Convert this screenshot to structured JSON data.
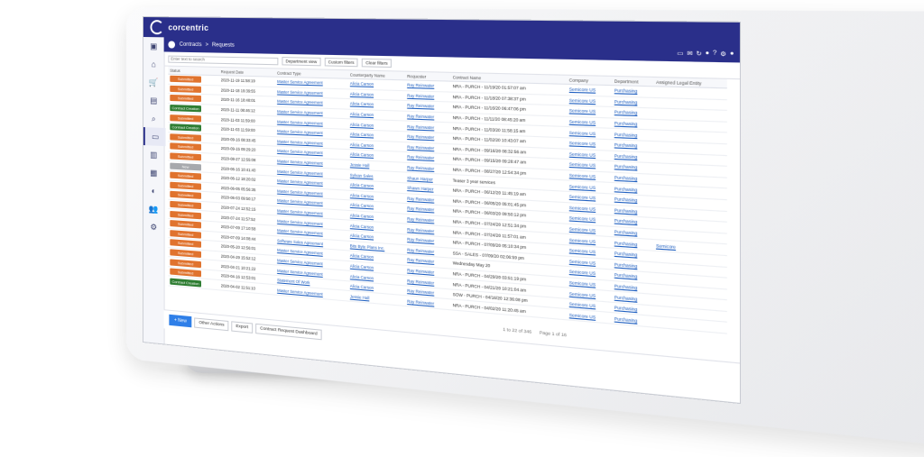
{
  "brand": {
    "name": "corcentric"
  },
  "breadcrumb": {
    "root": "Contracts",
    "sep": ">",
    "current": "Requests"
  },
  "toolbar": {
    "search_placeholder": "Enter text to search",
    "department": "Department view",
    "custom_filters": "Custom filters",
    "clear_filters": "Clear filters"
  },
  "headers": [
    "Status",
    "Request Date",
    "Contract Type",
    "Counterparty Name",
    "Requester",
    "Contract Name",
    "Company",
    "Department",
    "Assigned Legal Entity"
  ],
  "status_colors": {
    "Submitted": "#e0732e",
    "Contract Creation": "#2e7d32",
    "New": "#a7a9ad"
  },
  "rows": [
    {
      "status": "Submitted",
      "date": "2020-11-19 11:58:19",
      "type": "Master Service Agreement",
      "cp": "Alicia Carson",
      "req": "Ray Reinwater",
      "name": "NRA - PURCH - 11/19/20 01:57:07 am",
      "company": "Semicore US",
      "dept": "Purchasing",
      "ent": ""
    },
    {
      "status": "Submitted",
      "date": "2020-11-18 19:39:55",
      "type": "Master Service Agreement",
      "cp": "Alicia Carson",
      "req": "Ray Reinwater",
      "name": "NRA - PURCH - 11/18/20 07:38:37 pm",
      "company": "Semicore US",
      "dept": "Purchasing",
      "ent": ""
    },
    {
      "status": "Submitted",
      "date": "2020-11-16 18:48:01",
      "type": "Master Service Agreement",
      "cp": "Alicia Carson",
      "req": "Ray Reinwater",
      "name": "NRA - PURCH - 11/16/20 06:47:06 pm",
      "company": "Semicore US",
      "dept": "Purchasing",
      "ent": ""
    },
    {
      "status": "Contract Creation",
      "date": "2020-11-11 08:46:12",
      "type": "Master Service Agreement",
      "cp": "Alicia Carson",
      "req": "Ray Reinwater",
      "name": "NRA - PURCH - 11/11/20 08:45:20 am",
      "company": "Semicore US",
      "dept": "Purchasing",
      "ent": ""
    },
    {
      "status": "Submitted",
      "date": "2020-11-03 11:59:00",
      "type": "Master Service Agreement",
      "cp": "Alicia Carson",
      "req": "Ray Reinwater",
      "name": "NRA - PURCH - 11/03/20 11:58:15 am",
      "company": "Semicore US",
      "dept": "Purchasing",
      "ent": ""
    },
    {
      "status": "Contract Creation",
      "date": "2020-11-03 11:59:00",
      "type": "Master Service Agreement",
      "cp": "Alicia Carson",
      "req": "Ray Reinwater",
      "name": "NRA - PURCH - 11/02/20 10:43:07 am",
      "company": "Semicore US",
      "dept": "Purchasing",
      "ent": ""
    },
    {
      "status": "Submitted",
      "date": "2020-09-16 08:33:45",
      "type": "Master Service Agreement",
      "cp": "Alicia Carson",
      "req": "Ray Reinwater",
      "name": "NRA - PURCH - 09/16/20 08:32:56 am",
      "company": "Semicore US",
      "dept": "Purchasing",
      "ent": ""
    },
    {
      "status": "Submitted",
      "date": "2020-09-15 09:29:20",
      "type": "Master Service Agreement",
      "cp": "Alicia Carson",
      "req": "Ray Reinwater",
      "name": "NRA - PURCH - 09/15/20 09:28:47 am",
      "company": "Semicore US",
      "dept": "Purchasing",
      "ent": ""
    },
    {
      "status": "Submitted",
      "date": "2020-08-27 12:55:08",
      "type": "Master Service Agreement",
      "cp": "Jessie Hall",
      "req": "Ray Reinwater",
      "name": "NRA - PURCH - 08/27/20 12:54:34 pm",
      "company": "Semicore US",
      "dept": "Purchasing",
      "ent": ""
    },
    {
      "status": "New",
      "date": "2020-06-16 10:41:40",
      "type": "Master Service Agreement",
      "cp": "Sylvan Sales",
      "req": "Shaun Harper",
      "name": "Teaser 3 year services",
      "company": "Semicore US",
      "dept": "Purchasing",
      "ent": ""
    },
    {
      "status": "Submitted",
      "date": "2020-06-12 18:20:02",
      "type": "Master Service Agreement",
      "cp": "Alicia Carson",
      "req": "Shawn Harper",
      "name": "NRA - PURCH - 06/12/20 11:45:19 am",
      "company": "Semicore US",
      "dept": "Purchasing",
      "ent": ""
    },
    {
      "status": "Submitted",
      "date": "2020-06-05 05:56:35",
      "type": "Master Service Agreement",
      "cp": "Alicia Carson",
      "req": "Ray Reinwater",
      "name": "NRA - PURCH - 06/05/20 05:01:45 pm",
      "company": "Semicore US",
      "dept": "Purchasing",
      "ent": ""
    },
    {
      "status": "Submitted",
      "date": "2020-06-03 09:50:17",
      "type": "Master Service Agreement",
      "cp": "Alicia Carson",
      "req": "Ray Reinwater",
      "name": "NRA - PURCH - 06/03/20 09:50:12 pm",
      "company": "Semicore US",
      "dept": "Purchasing",
      "ent": ""
    },
    {
      "status": "Submitted",
      "date": "2020-07-24 12:52:15",
      "type": "Master Service Agreement",
      "cp": "Alicia Carson",
      "req": "Ray Reinwater",
      "name": "NRA - PURCH - 07/24/20 12:51:34 pm",
      "company": "Semicore US",
      "dept": "Purchasing",
      "ent": ""
    },
    {
      "status": "Submitted",
      "date": "2020-07-24 11:57:52",
      "type": "Master Service Agreement",
      "cp": "Alicia Carson",
      "req": "Ray Reinwater",
      "name": "NRA - PURCH - 07/24/20 11:57:01 am",
      "company": "Semicore US",
      "dept": "Purchasing",
      "ent": "Semicore"
    },
    {
      "status": "Submitted",
      "date": "2020-07-09 17:10:58",
      "type": "Master Service Agreement",
      "cp": "Alicia Carson",
      "req": "Ray Reinwater",
      "name": "NRA - PURCH - 07/09/20 05:10:34 pm",
      "company": "Semicore US",
      "dept": "Purchasing",
      "ent": ""
    },
    {
      "status": "Submitted",
      "date": "2020-07-09 14:08:44",
      "type": "Software Sales Agreement",
      "cp": "Bits Byte Plans Inc.",
      "req": "Ray Reinwater",
      "name": "SSA - SALES - 07/09/20 02:06:59 pm",
      "company": "Semicore US",
      "dept": "Purchasing",
      "ent": ""
    },
    {
      "status": "Submitted",
      "date": "2020-05-20 12:56:01",
      "type": "Master Service Agreement",
      "cp": "Alicia Carson",
      "req": "Ray Reinwater",
      "name": "Wednesday May 20",
      "company": "Semicore US",
      "dept": "Purchasing",
      "ent": ""
    },
    {
      "status": "Submitted",
      "date": "2020-04-29 15:52:12",
      "type": "Master Service Agreement",
      "cp": "Alicia Carson",
      "req": "Ray Reinwater",
      "name": "NRA - PURCH - 04/29/20 03:51:19 pm",
      "company": "Semicore US",
      "dept": "Purchasing",
      "ent": ""
    },
    {
      "status": "Submitted",
      "date": "2020-04-21 10:21:22",
      "type": "Master Service Agreement",
      "cp": "Alicia Carson",
      "req": "Ray Reinwater",
      "name": "NRA - PURCH - 04/21/20 10:21:04 am",
      "company": "Semicore US",
      "dept": "Purchasing",
      "ent": ""
    },
    {
      "status": "Submitted",
      "date": "2020-04-16 12:53:01",
      "type": "Statement Of Work",
      "cp": "Alicia Carson",
      "req": "Ray Reinwater",
      "name": "SOW - PURCH - 04/16/20 12:36:08 pm",
      "company": "Semicore US",
      "dept": "Purchasing",
      "ent": ""
    },
    {
      "status": "Contract Creation",
      "date": "2020-04-02 11:51:10",
      "type": "Master Service Agreement",
      "cp": "Jessie Hall",
      "req": "Ray Reinwater",
      "name": "NRA - PURCH - 04/02/20 11:20:45 am",
      "company": "Semicore US",
      "dept": "Purchasing",
      "ent": ""
    }
  ],
  "pager": {
    "left": "1 to 22 of 346",
    "right": "Page 1 of 16"
  },
  "footer": {
    "new": "+ New",
    "other": "Other Actions",
    "export": "Export",
    "dashboard": "Contract Request Dashboard"
  }
}
